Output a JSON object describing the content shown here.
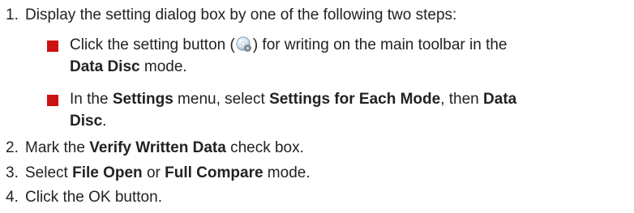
{
  "step1": {
    "number": "1.",
    "text": "Display the setting dialog box by one of the following two steps:"
  },
  "sub_a": {
    "t1": "Click the setting button (",
    "icon": "settings-disc-icon",
    "t2": ") for writing on the main toolbar in the",
    "t3": "Data Disc",
    "t4": " mode."
  },
  "sub_b": {
    "t1": "In the ",
    "t2": "Settings",
    "t3": " menu, select ",
    "t4": "Settings for Each Mode",
    "t5": ", then ",
    "t6": "Data",
    "t7": "Disc",
    "t8": "."
  },
  "step2": {
    "number": "2.",
    "t1": "Mark the ",
    "t2": "Verify Written Data",
    "t3": " check box."
  },
  "step3": {
    "number": "3.",
    "t1": "Select ",
    "t2": "File Open",
    "t3": " or ",
    "t4": "Full Compare",
    "t5": " mode."
  },
  "step4": {
    "number": "4.",
    "t1": "Click the OK button."
  },
  "colors": {
    "bullet": "#cc1111",
    "text": "#222222"
  }
}
